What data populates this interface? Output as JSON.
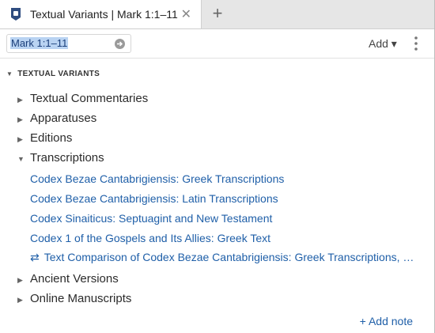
{
  "tab": {
    "title": "Textual Variants | Mark 1:1–11",
    "close_glyph": "✕",
    "new_tab_glyph": "+",
    "icon": "shield-book-icon"
  },
  "toolbar": {
    "reference_value": "Mark 1:1–11",
    "add_label": "Add ▾",
    "go_icon": "arrow-right-circle-icon",
    "menu_icon": "kebab-menu-icon"
  },
  "section": {
    "title": "TEXTUAL VARIANTS"
  },
  "categories": [
    {
      "label": "Textual Commentaries",
      "expanded": false
    },
    {
      "label": "Apparatuses",
      "expanded": false
    },
    {
      "label": "Editions",
      "expanded": false
    },
    {
      "label": "Transcriptions",
      "expanded": true
    }
  ],
  "transcriptions": [
    "Codex Bezae Cantabrigiensis: Greek Transcriptions",
    "Codex Bezae Cantabrigiensis: Latin Transcriptions",
    "Codex Sinaiticus: Septuagint and New Testament",
    "Codex 1 of the Gospels and Its Allies: Greek Text"
  ],
  "comparison": {
    "label": "Text Comparison of Codex Bezae Cantabrigiensis: Greek Transcriptions, Si…",
    "icon": "swap-arrows-icon"
  },
  "more_categories": [
    {
      "label": "Ancient Versions",
      "expanded": false
    },
    {
      "label": "Online Manuscripts",
      "expanded": false
    }
  ],
  "footer": {
    "add_note_label": "+ Add note"
  },
  "colors": {
    "link": "#1f5fa8",
    "selection": "#b9d3f2",
    "tab_icon": "#2f4d80"
  }
}
